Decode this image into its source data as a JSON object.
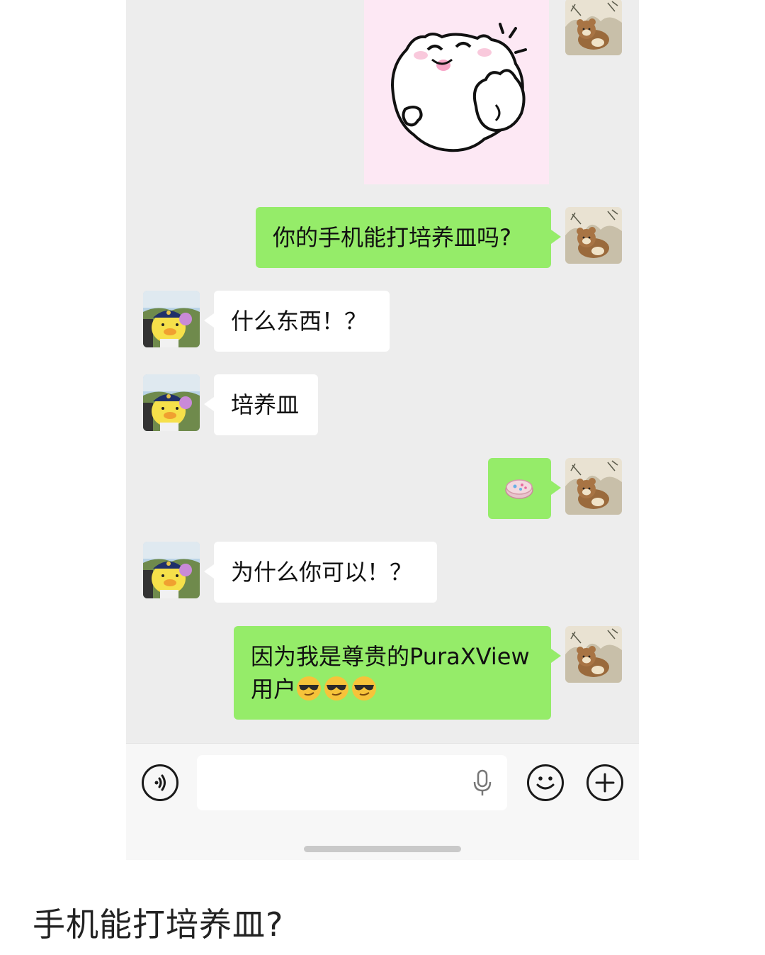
{
  "messages": [
    {
      "side": "right",
      "type": "sticker",
      "sticker": "white-cat-peace-sign"
    },
    {
      "side": "right",
      "type": "text",
      "text": "你的手机能打培养皿吗?"
    },
    {
      "side": "left",
      "type": "text",
      "text": "什么东西！？"
    },
    {
      "side": "left",
      "type": "text",
      "text": "培养皿"
    },
    {
      "side": "right",
      "type": "emoji",
      "emoji": "petri-dish-emoji"
    },
    {
      "side": "left",
      "type": "text",
      "text": "为什么你可以！？"
    },
    {
      "side": "right",
      "type": "text",
      "text_line1": "因为我是尊贵的PuraXView",
      "text_line2": "用户",
      "emoji_suffix": [
        "sunglasses-emoji",
        "sunglasses-emoji",
        "sunglasses-emoji"
      ]
    }
  ],
  "avatars": {
    "me": "bear-landscape-avatar",
    "friend": "duck-plush-avatar"
  },
  "input_bar": {
    "icons": [
      "voice-icon",
      "microphone-icon",
      "emoji-face-icon",
      "plus-icon"
    ]
  },
  "caption": "手机能打培养皿?",
  "colors": {
    "bubble_sent": "#95ec69",
    "bubble_received": "#ffffff",
    "chat_bg": "#ededed"
  }
}
